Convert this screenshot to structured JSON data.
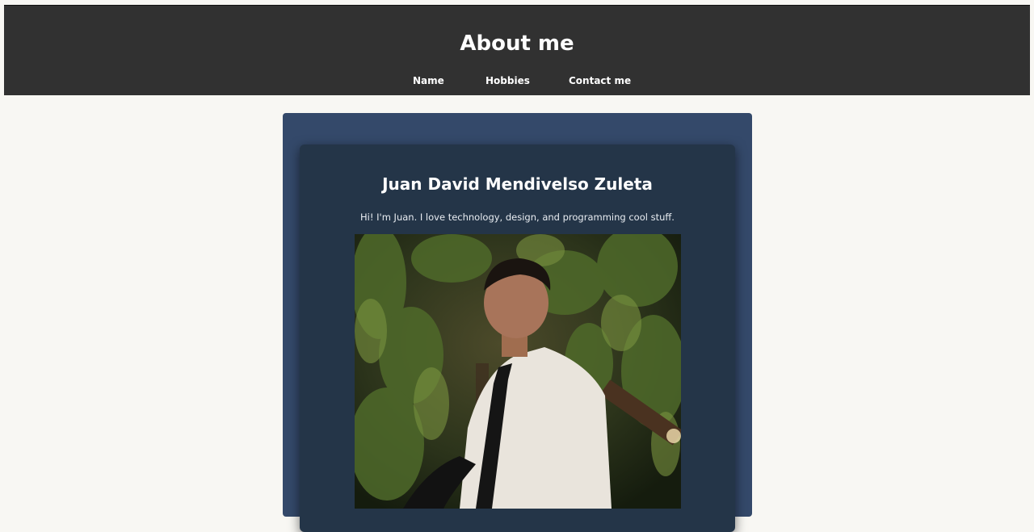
{
  "header": {
    "title": "About me",
    "nav": [
      {
        "label": "Name"
      },
      {
        "label": "Hobbies"
      },
      {
        "label": "Contact me"
      }
    ]
  },
  "profile": {
    "name": "Juan David Mendivelso Zuleta",
    "intro": "Hi! I'm Juan. I love technology, design, and programming cool stuff.",
    "photo": "portrait photo of a young man in white shirt and black tie in front of ferns"
  },
  "colors": {
    "background": "#f8f7f3",
    "header": "#313131",
    "card_outer": "#34496a",
    "card_inner": "#243548",
    "text": "#ffffff"
  }
}
